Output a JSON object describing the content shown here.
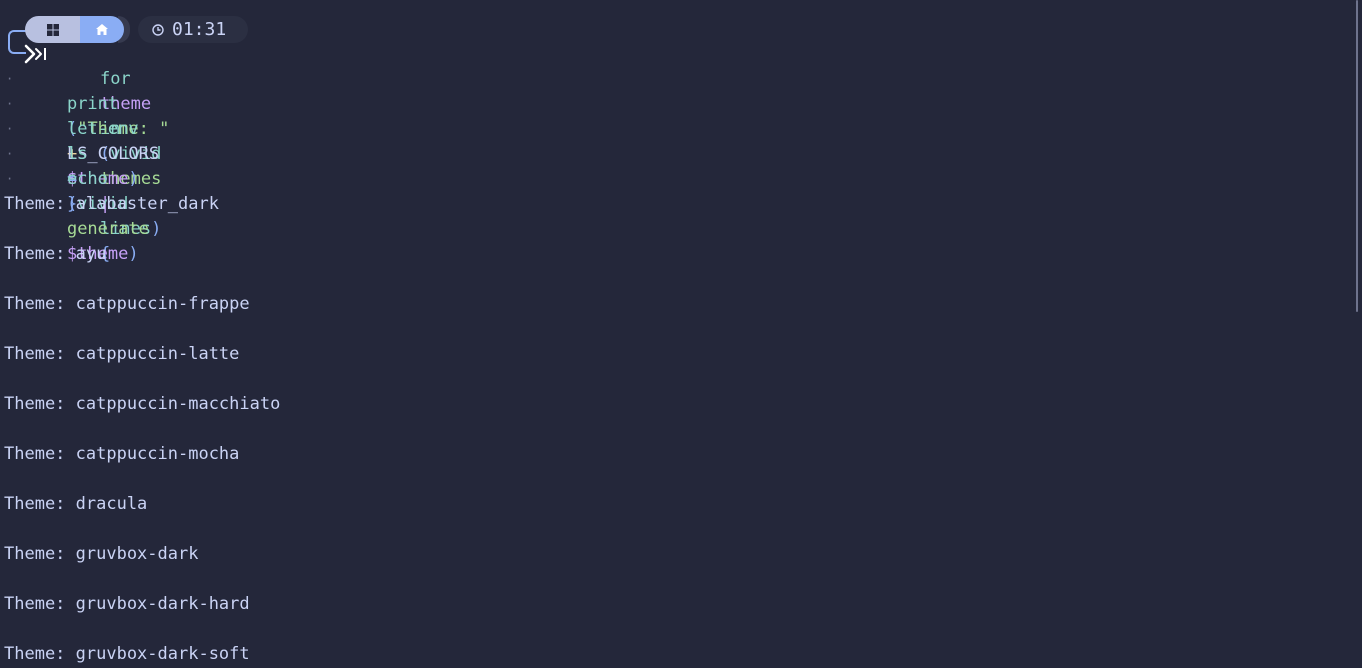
{
  "prompt": {
    "time": "01:31",
    "os_icon": "windows-icon",
    "dir_icon": "home-icon",
    "clock_icon": "clock-icon"
  },
  "code": {
    "line1": {
      "kw_for": "for",
      "var": "theme",
      "kw_in": "in",
      "open": "(",
      "cmd": "vivid",
      "sub": "themes",
      "pipe": "|",
      "sub2": "lines",
      "close": ")",
      "brace": "{"
    },
    "line2": {
      "cmd": "print",
      "open": "(",
      "str": "\"Theme: \"",
      "op": "+",
      "var": "$theme",
      "close": ")"
    },
    "line3": {
      "cmd": "let-env",
      "name": "LS_COLORS",
      "eq": "=",
      "open": "(",
      "cmd2": "vivid",
      "sub": "generate",
      "var": "$theme",
      "close": ")"
    },
    "line4": {
      "cmd": "ls"
    },
    "line5": {
      "cmd": "echo"
    },
    "line6": {
      "brace": "}"
    }
  },
  "output": [
    "Theme: alabaster_dark",
    "Theme: ayu",
    "Theme: catppuccin-frappe",
    "Theme: catppuccin-latte",
    "Theme: catppuccin-macchiato",
    "Theme: catppuccin-mocha",
    "Theme: dracula",
    "Theme: gruvbox-dark",
    "Theme: gruvbox-dark-hard",
    "Theme: gruvbox-dark-soft"
  ],
  "colors": {
    "background": "#24273a",
    "text": "#cad3f5",
    "teal": "#8bd5ca",
    "mauve": "#c6a0f6",
    "blue": "#8aadf4",
    "green": "#a6da95",
    "yellow": "#eed49f"
  }
}
